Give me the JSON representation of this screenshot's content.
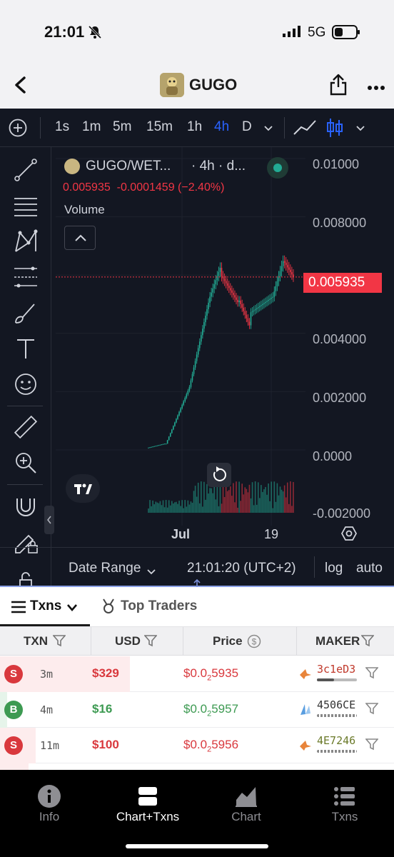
{
  "status": {
    "time": "21:01",
    "network": "5G"
  },
  "header": {
    "title": "GUGO"
  },
  "chart_toolbar": {
    "timeframes": [
      "1s",
      "1m",
      "5m",
      "15m",
      "1h",
      "4h",
      "D"
    ],
    "active_timeframe": "4h"
  },
  "chart": {
    "symbol": "GUGO/WET...",
    "interval_text": "· 4h · d...",
    "values_line": "0.005935  -0.0001459 (−2.40%)",
    "volume_label": "Volume",
    "y_ticks": [
      "0.01000",
      "0.008000",
      "0.006000",
      "0.004000",
      "0.002000",
      "0.0000",
      "-0.002000"
    ],
    "current_price": "0.005935",
    "x_ticks": [
      "Jul",
      "19"
    ]
  },
  "chart_footer": {
    "date_range_label": "Date Range",
    "clock": "21:01:20 (UTC+2)",
    "log_label": "log",
    "auto_label": "auto"
  },
  "txns": {
    "tab_txns": "Txns",
    "tab_top_traders": "Top Traders",
    "columns": [
      "TXN",
      "USD",
      "Price",
      "MAKER"
    ],
    "rows": [
      {
        "type": "S",
        "age": "3m",
        "usd": "$329",
        "price_prefix": "$0.0",
        "price_sub": "2",
        "price_rest": "5935",
        "maker": "3c1eD3"
      },
      {
        "type": "B",
        "age": "4m",
        "usd": "$16",
        "price_prefix": "$0.0",
        "price_sub": "2",
        "price_rest": "5957",
        "maker": "4506CE"
      },
      {
        "type": "S",
        "age": "11m",
        "usd": "$100",
        "price_prefix": "$0.0",
        "price_sub": "2",
        "price_rest": "5956",
        "maker": "4E7246"
      }
    ]
  },
  "bottom_nav": {
    "items": [
      "Info",
      "Chart+Txns",
      "Chart",
      "Txns"
    ],
    "active": "Chart+Txns"
  },
  "colors": {
    "up": "#22ab94",
    "down": "#f23645",
    "active_tf": "#2962ff",
    "sell": "#d9383d",
    "buy": "#3d9a52"
  }
}
